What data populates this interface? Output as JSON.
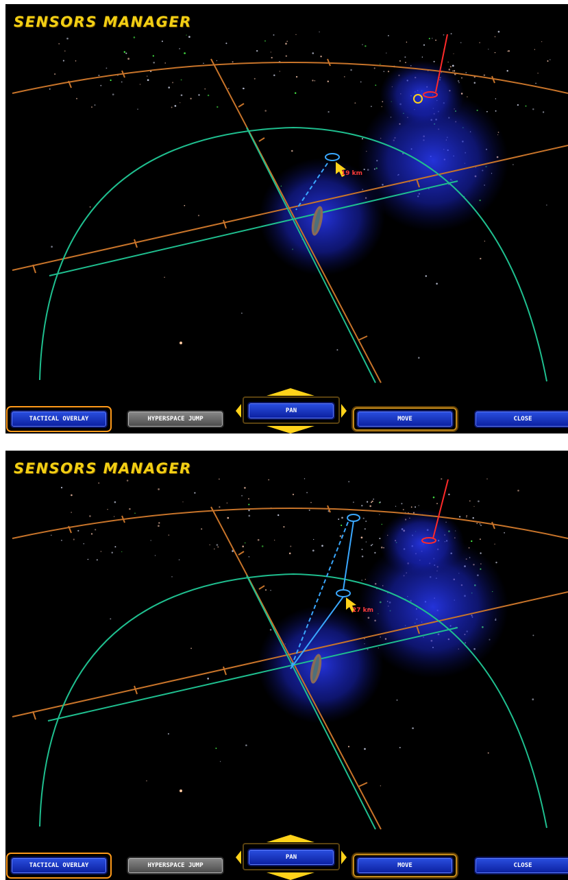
{
  "screens": [
    {
      "title": "SENSORS MANAGER",
      "distance_label": "19 km",
      "buttons": {
        "tactical_overlay": "TACTICAL OVERLAY",
        "hyperspace_jump": "HYPERSPACE JUMP",
        "pan": "PAN",
        "move": "MOVE",
        "close": "CLOSE"
      }
    },
    {
      "title": "SENSORS MANAGER",
      "distance_label": "27 km",
      "buttons": {
        "tactical_overlay": "TACTICAL OVERLAY",
        "hyperspace_jump": "HYPERSPACE JUMP",
        "pan": "PAN",
        "move": "MOVE",
        "close": "CLOSE"
      }
    }
  ],
  "colors": {
    "title": "#f2cf14",
    "grid_orange": "#c8742a",
    "grid_teal": "#1fbf8f",
    "sensor_blue": "#1f2fd0",
    "waypoint_blue": "#3aa8ff",
    "heading_red": "#ff2a2a",
    "button_blue": "#1a3ad0",
    "button_grey": "#6a6a6a",
    "highlight_orange": "#ff9a1a"
  },
  "icons": {
    "cursor": "move-cursor-icon",
    "ship": "capital-ship-icon",
    "waypoint": "waypoint-ring-icon",
    "target": "target-ring-icon"
  }
}
